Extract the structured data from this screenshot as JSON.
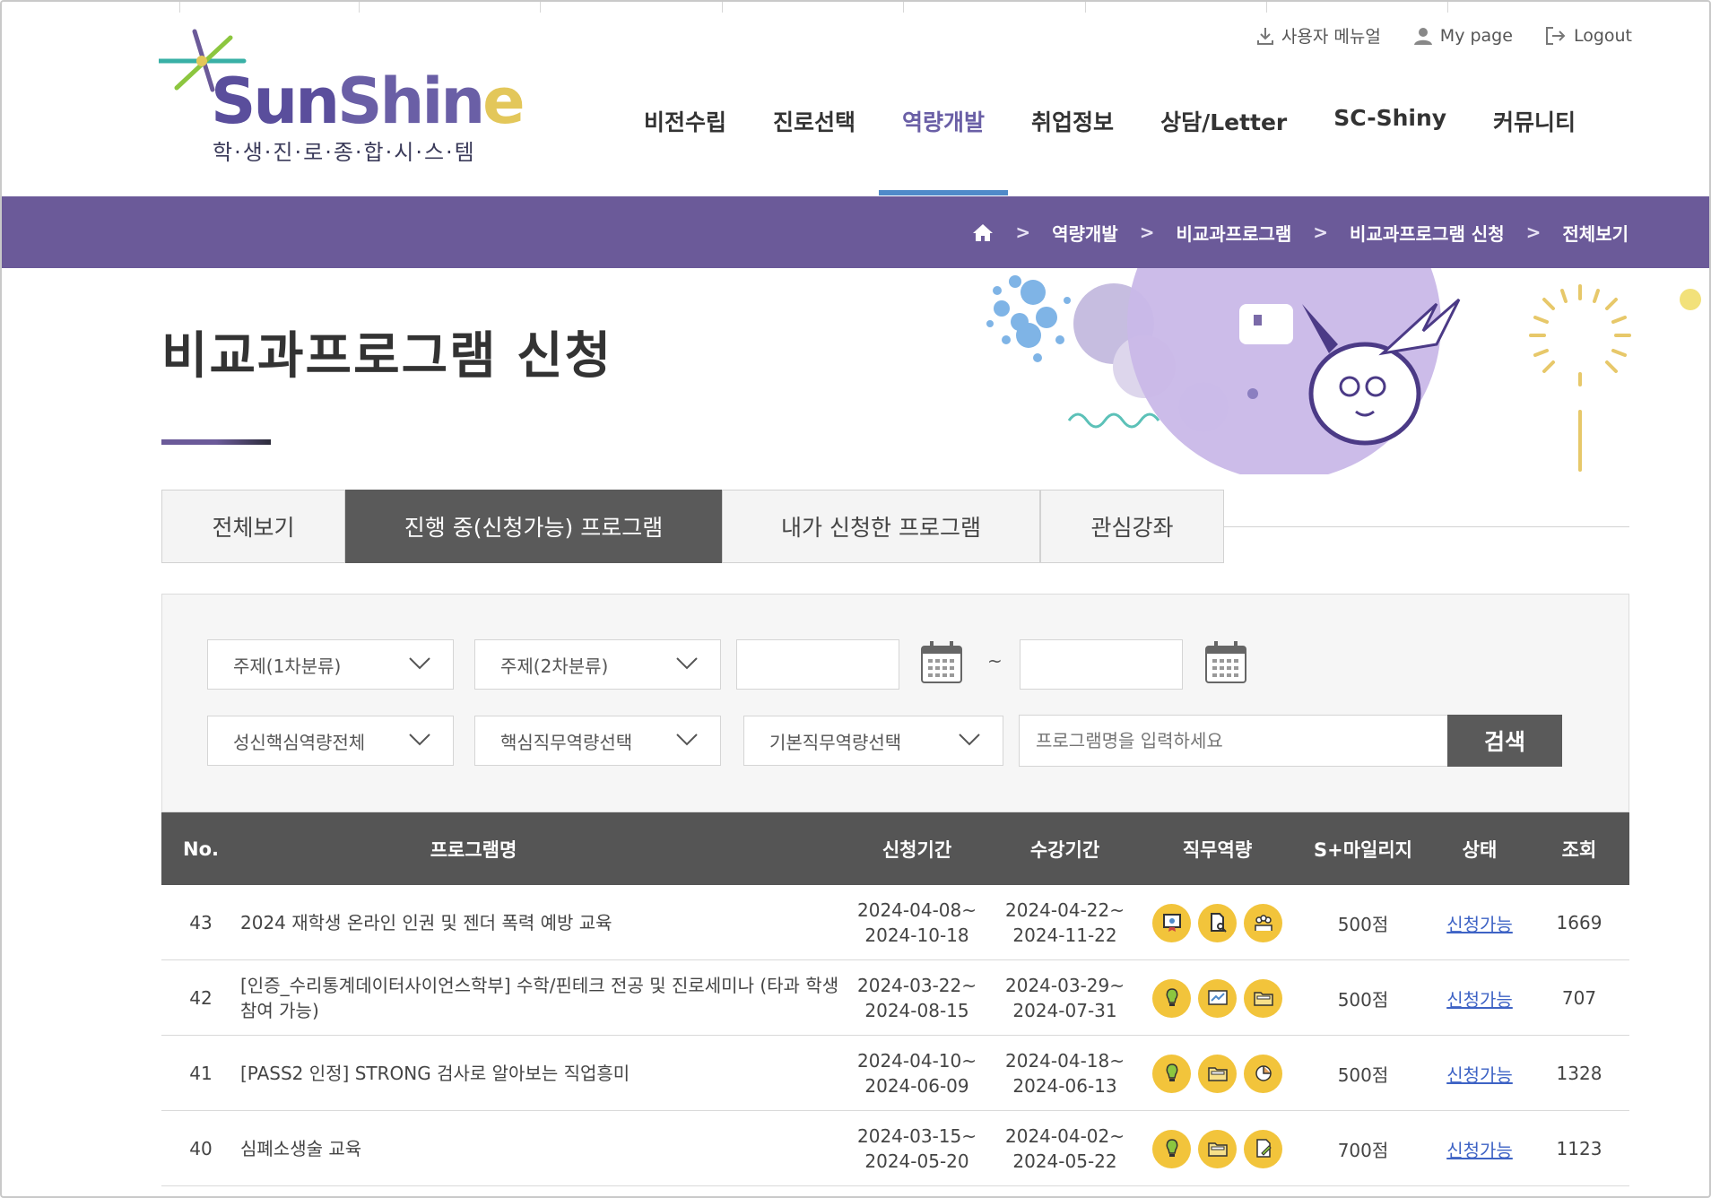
{
  "logo": {
    "wordmark_part1": "Sun",
    "wordmark_part2": "Shin",
    "wordmark_part3": "e",
    "subtitle": "학·생·진·로·종·합·시·스·템"
  },
  "utility": [
    {
      "label": "사용자 메뉴얼",
      "icon": "download-icon"
    },
    {
      "label": "My page",
      "icon": "user-icon"
    },
    {
      "label": "Logout",
      "icon": "logout-icon"
    }
  ],
  "nav": [
    "비전수립",
    "진로선택",
    "역량개발",
    "취업정보",
    "상담/Letter",
    "SC-Shiny",
    "커뮤니티"
  ],
  "nav_active": "역량개발",
  "breadcrumb": [
    "역량개발",
    "비교과프로그램",
    "비교과프로그램 신청",
    "전체보기"
  ],
  "breadcrumb_sep": ">",
  "page_title": "비교과프로그램 신청",
  "tabs": [
    "전체보기",
    "진행 중(신청가능) 프로그램",
    "내가 신청한 프로그램",
    "관심강좌"
  ],
  "active_tab": "진행 중(신청가능) 프로그램",
  "filters": {
    "topic1": "주제(1차분류)",
    "topic2": "주제(2차분류)",
    "date_sep": "~",
    "core_competency": "성신핵심역량전체",
    "core_job": "핵심직무역량선택",
    "basic_job": "기본직무역량선택",
    "keyword_placeholder": "프로그램명을 입력하세요",
    "search_button": "검색"
  },
  "table": {
    "headers": [
      "No.",
      "프로그램명",
      "신청기간",
      "수강기간",
      "직무역량",
      "S+마일리지",
      "상태",
      "조회"
    ],
    "rows": [
      {
        "no": "43",
        "name": "2024 재학생 온라인 인권 및 젠더 폭력 예방 교육",
        "apply_start": "2024-04-08~",
        "apply_end": "2024-10-18",
        "course_start": "2024-04-22~",
        "course_end": "2024-11-22",
        "icons": [
          "certificate-icon",
          "document-search-icon",
          "team-icon"
        ],
        "mileage": "500점",
        "status": "신청가능",
        "views": "1669"
      },
      {
        "no": "42",
        "name": "[인증_수리통계데이터사이언스학부] 수학/핀테크 전공 및 진로세미나 (타과 학생 참여 가능)",
        "apply_start": "2024-03-22~",
        "apply_end": "2024-08-15",
        "course_start": "2024-03-29~",
        "course_end": "2024-07-31",
        "icons": [
          "lightbulb-icon",
          "chart-icon",
          "folder-icon"
        ],
        "mileage": "500점",
        "status": "신청가능",
        "views": "707"
      },
      {
        "no": "41",
        "name": "[PASS2 인정] STRONG 검사로 알아보는 직업흥미",
        "apply_start": "2024-04-10~",
        "apply_end": "2024-06-09",
        "course_start": "2024-04-18~",
        "course_end": "2024-06-13",
        "icons": [
          "lightbulb-icon",
          "folder-icon",
          "puzzle-icon"
        ],
        "mileage": "500점",
        "status": "신청가능",
        "views": "1328"
      },
      {
        "no": "40",
        "name": "심폐소생술 교육",
        "apply_start": "2024-03-15~",
        "apply_end": "2024-05-20",
        "course_start": "2024-04-02~",
        "course_end": "2024-05-22",
        "icons": [
          "lightbulb-icon",
          "folder-icon",
          "edit-document-icon"
        ],
        "mileage": "700점",
        "status": "신청가능",
        "views": "1123"
      }
    ]
  },
  "colors": {
    "brand_purple": "#6b5a99",
    "active_nav_underline": "#4f8ac9",
    "table_header": "#555555",
    "icon_badge": "#f2c43b",
    "status_link": "#3e63c5"
  }
}
